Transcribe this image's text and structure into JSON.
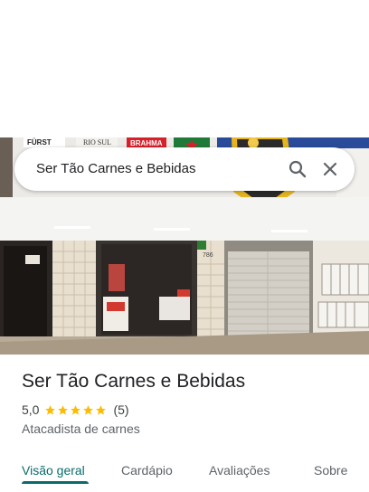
{
  "search": {
    "query": "Ser Tão Carnes e Bebidas"
  },
  "photo": {
    "signs": [
      "FÜRST",
      "RIO SUL",
      "BRAHMA"
    ],
    "door_number": "786"
  },
  "place": {
    "name": "Ser Tão Carnes e Bebidas",
    "rating": "5,0",
    "stars": 5,
    "reviews": "(5)",
    "category": "Atacadista de carnes"
  },
  "tabs": [
    {
      "label": "Visão geral",
      "active": true
    },
    {
      "label": "Cardápio",
      "active": false
    },
    {
      "label": "Avaliações",
      "active": false
    },
    {
      "label": "Sobre",
      "active": false
    }
  ],
  "colors": {
    "accent": "#0b6b6b",
    "star": "#fbbc04"
  }
}
